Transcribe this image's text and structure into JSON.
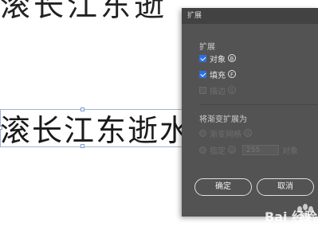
{
  "canvas": {
    "top_text": "滚长江东逝",
    "main_text": "滚长江东逝水"
  },
  "dialog": {
    "title": "扩展",
    "expand_section_label": "扩展",
    "object_label": "对象",
    "object_hotkey": "B",
    "object_checked": true,
    "fill_label": "填充",
    "fill_hotkey": "F",
    "fill_checked": true,
    "stroke_label": "描边",
    "stroke_hotkey": "S",
    "stroke_enabled": false,
    "gradient_section_label": "将渐变扩展为",
    "gradient_mesh_label": "渐变网格",
    "gradient_mesh_hotkey": "G",
    "specify_label": "指定",
    "specify_hotkey": "O",
    "specify_value": "255",
    "specify_unit": "对象",
    "ok_label": "确定",
    "cancel_label": "取消"
  },
  "colors": {
    "dialog_bg": "#535353",
    "titlebar_bg": "#424242",
    "checkbox_checked": "#2d6ee3"
  },
  "watermark": {
    "text": "Bai 经验"
  }
}
